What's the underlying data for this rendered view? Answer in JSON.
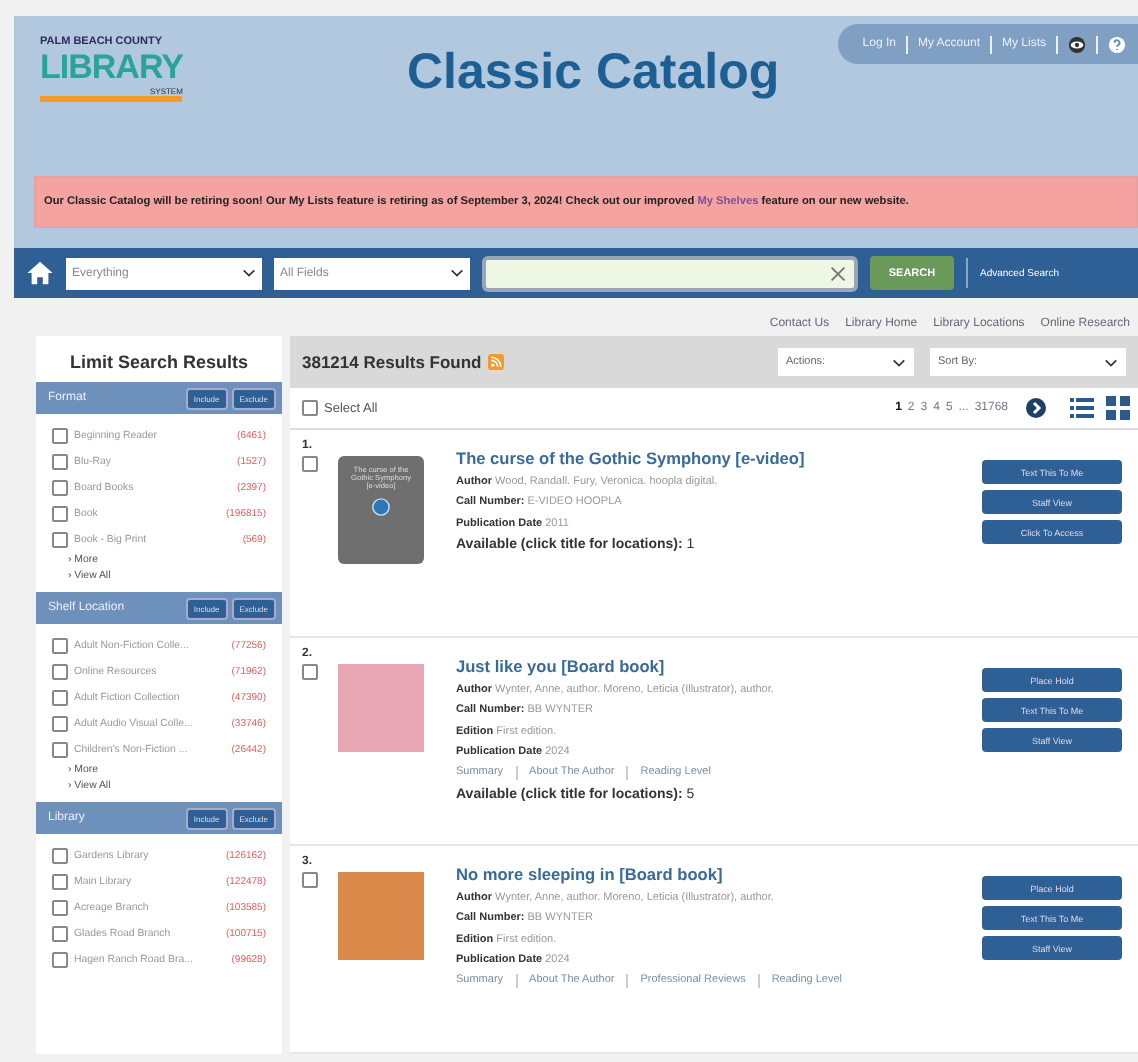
{
  "header": {
    "logo": {
      "line_1": "PALM BEACH COUNTY",
      "line_2": "LIBRARY",
      "line_3": "SYSTEM"
    },
    "title": "Classic Catalog",
    "top_links": [
      "Log In",
      "My Account",
      "My Lists"
    ]
  },
  "banner": {
    "before": "Our Classic Catalog will be retiring soon! Our My Lists feature is retiring as of September 3, 2024! Check out our improved ",
    "link": "My Shelves",
    "after": " feature on our new website."
  },
  "search": {
    "scope": "Everything",
    "field": "All Fields",
    "button": "SEARCH",
    "advanced": "Advanced Search"
  },
  "nav_links": [
    "Contact Us",
    "Library Home",
    "Library Locations",
    "Online Research"
  ],
  "sidebar": {
    "title": "Limit Search Results",
    "facets": [
      {
        "title": "Format",
        "include": "Include",
        "exclude": "Exclude",
        "more": "› More",
        "view_all": "› View All",
        "items": [
          {
            "label": "Beginning Reader",
            "count": "(6461)",
            "checked": false
          },
          {
            "label": "Blu-Ray",
            "count": "(1527)",
            "checked": false
          },
          {
            "label": "Board Books",
            "count": "(2397)",
            "checked": false
          },
          {
            "label": "Book",
            "count": "(196815)",
            "checked": false
          },
          {
            "label": "Book - Big Print",
            "count": "(569)",
            "checked": false
          }
        ]
      },
      {
        "title": "Shelf Location",
        "include": "Include",
        "exclude": "Exclude",
        "more": "› More",
        "view_all": "› View All",
        "items": [
          {
            "label": "Adult Non-Fiction Colle...",
            "count": "(77256)",
            "checked": false
          },
          {
            "label": "Online Resources",
            "count": "(71962)",
            "checked": false
          },
          {
            "label": "Adult Fiction Collection",
            "count": "(47390)",
            "checked": false
          },
          {
            "label": "Adult Audio Visual Colle...",
            "count": "(33746)",
            "checked": false
          },
          {
            "label": "Children's Non-Fiction ...",
            "count": "(26442)",
            "checked": false
          }
        ]
      },
      {
        "title": "Library",
        "include": "Include",
        "exclude": "Exclude",
        "items": [
          {
            "label": "Gardens Library",
            "count": "(126162)",
            "checked": false
          },
          {
            "label": "Main Library",
            "count": "(122478)",
            "checked": false
          },
          {
            "label": "Acreage Branch",
            "count": "(103585)",
            "checked": false
          },
          {
            "label": "Glades Road Branch",
            "count": "(100715)",
            "checked": false
          },
          {
            "label": "Hagen Ranch Road Bra...",
            "count": "(99628)",
            "checked": false
          }
        ]
      }
    ]
  },
  "results": {
    "count": "381214 Results Found",
    "actions": "Actions:",
    "sort": "Sort By:",
    "select_all": {
      "label": "Select All",
      "checked": false
    },
    "pages": [
      {
        "label": "1",
        "selected": true
      },
      {
        "label": "2",
        "selected": false
      },
      {
        "label": "3",
        "selected": false
      },
      {
        "label": "4",
        "selected": false
      },
      {
        "label": "5",
        "selected": false
      }
    ],
    "ellipsis": "...",
    "last_page": "31768",
    "items": [
      {
        "number": "1.",
        "checked": false,
        "cover": {
          "kind": "generic",
          "text": "The curse of the Gothic Symphony [e-video]"
        },
        "title": "The curse of the Gothic Symphony [e-video]",
        "fields": [
          {
            "label": "Author",
            "value": "Wood, Randall. Fury, Veronica. hoopla digital."
          },
          {
            "label": "Call Number:",
            "value": "E-VIDEO HOOPLA"
          },
          {
            "label": "Publication Date",
            "value": "2011"
          }
        ],
        "availability": {
          "label": "Available (click title for locations):",
          "value": "1"
        },
        "buttons": [
          "Text This To Me",
          "Staff View",
          "Click To Access"
        ]
      },
      {
        "number": "2.",
        "checked": false,
        "cover": {
          "kind": "photo",
          "color": "#e9a7b6"
        },
        "title": "Just like you [Board book]",
        "fields": [
          {
            "label": "Author",
            "value": "Wynter, Anne, author. Moreno, Leticia (Illustrator), author."
          },
          {
            "label": "Call Number:",
            "value": "BB WYNTER"
          },
          {
            "label": "Edition",
            "value": "First edition."
          },
          {
            "label": "Publication Date",
            "value": "2024"
          }
        ],
        "links": [
          "Summary",
          "About The Author",
          "Reading Level"
        ],
        "availability": {
          "label": "Available (click title for locations):",
          "value": "5"
        },
        "buttons": [
          "Place Hold",
          "Text This To Me",
          "Staff View"
        ]
      },
      {
        "number": "3.",
        "checked": false,
        "cover": {
          "kind": "photo",
          "color": "#d98a4a"
        },
        "title": "No more sleeping in [Board book]",
        "fields": [
          {
            "label": "Author",
            "value": "Wynter, Anne, author. Moreno, Leticia (Illustrator), author."
          },
          {
            "label": "Call Number:",
            "value": "BB WYNTER"
          },
          {
            "label": "Edition",
            "value": "First edition."
          },
          {
            "label": "Publication Date",
            "value": "2024"
          }
        ],
        "links": [
          "Summary",
          "About The Author",
          "Professional Reviews",
          "Reading Level"
        ],
        "buttons": [
          "Place Hold",
          "Text This To Me",
          "Staff View"
        ]
      }
    ]
  }
}
